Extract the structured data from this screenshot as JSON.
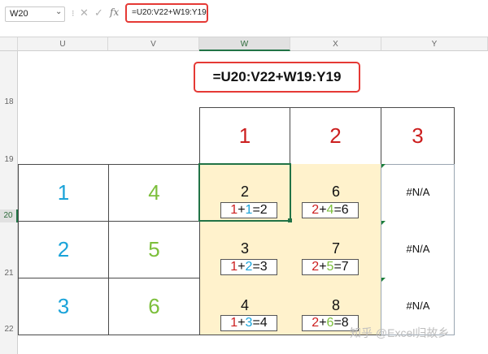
{
  "formula_bar": {
    "name_box": "W20",
    "caret": "⌄",
    "separator": "⁝",
    "cancel_icon": "✕",
    "enter_icon": "✓",
    "fx_label": "fx",
    "formula": "=U20:V22+W19:Y19"
  },
  "column_headers": [
    "U",
    "V",
    "W",
    "X",
    "Y"
  ],
  "row_headers": [
    "18",
    "19",
    "20",
    "21",
    "22"
  ],
  "annotation": "=U20:V22+W19:Y19",
  "header_row": [
    "1",
    "2",
    "3"
  ],
  "left_block": [
    [
      "1",
      "4"
    ],
    [
      "2",
      "5"
    ],
    [
      "3",
      "6"
    ]
  ],
  "results": [
    {
      "sum": "2",
      "eq": {
        "a": "1",
        "op": "+",
        "b": "1",
        "eqs": "=",
        "r": "2"
      }
    },
    {
      "sum": "6",
      "eq": {
        "a": "2",
        "op": "+",
        "b": "4",
        "eqs": "=",
        "r": "6"
      }
    },
    {
      "sum": "3",
      "eq": {
        "a": "1",
        "op": "+",
        "b": "2",
        "eqs": "=",
        "r": "3"
      }
    },
    {
      "sum": "7",
      "eq": {
        "a": "2",
        "op": "+",
        "b": "5",
        "eqs": "=",
        "r": "7"
      }
    },
    {
      "sum": "4",
      "eq": {
        "a": "1",
        "op": "+",
        "b": "3",
        "eqs": "=",
        "r": "4"
      }
    },
    {
      "sum": "8",
      "eq": {
        "a": "2",
        "op": "+",
        "b": "6",
        "eqs": "=",
        "r": "8"
      }
    }
  ],
  "na": [
    "#N/A",
    "#N/A",
    "#N/A"
  ],
  "watermark": "知乎 @Excel归故乡",
  "colors": {
    "blue": "#1aa3d9",
    "green": "#7cbf3b",
    "red": "#cc1f1f",
    "highlight": "#fff2cc",
    "selection": "#217346",
    "annotation_border": "#e53935"
  }
}
